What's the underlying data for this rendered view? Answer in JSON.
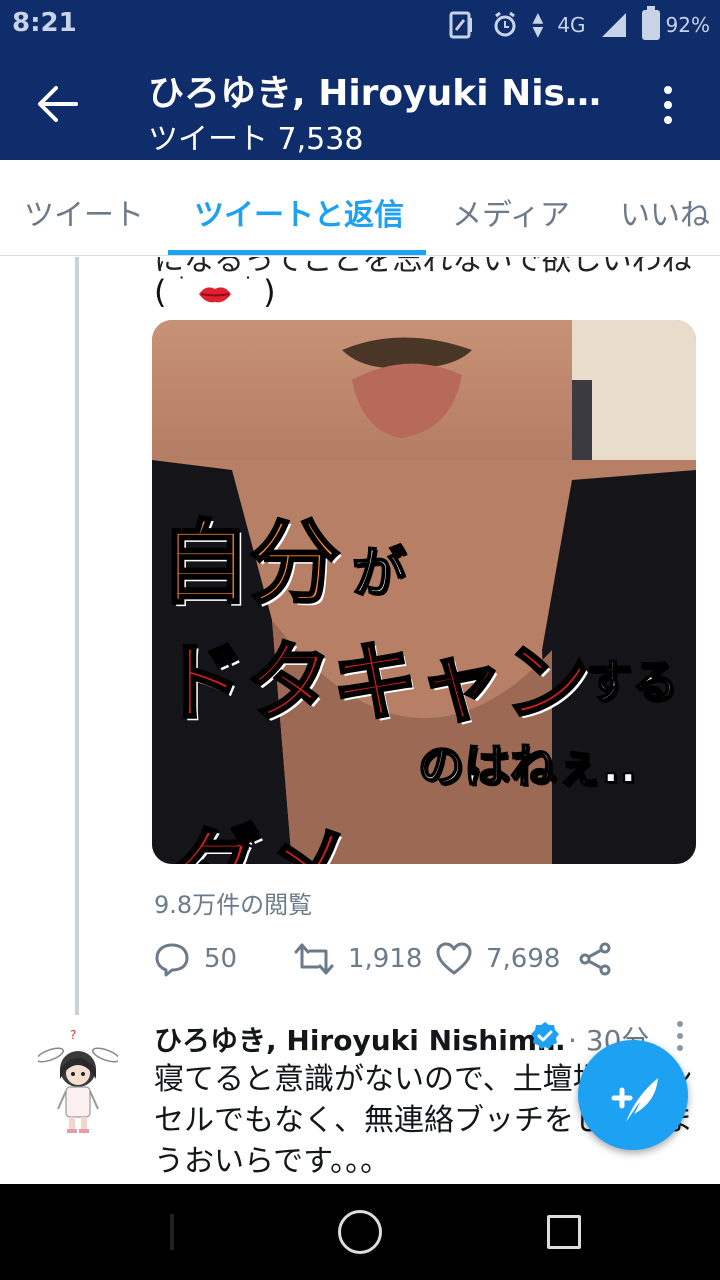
{
  "status_bar": {
    "time": "8:21",
    "network": "4G",
    "battery": "92%",
    "icons": [
      "nfc-icon",
      "alarm-icon",
      "data-arrows-icon",
      "signal-icon",
      "battery-icon"
    ]
  },
  "header": {
    "title": "ひろゆき, Hiroyuki Nis…",
    "subtitle": "ツイート 7,538",
    "back_icon": "arrow-left-icon",
    "menu_icon": "more-vertical-icon"
  },
  "tabs": [
    {
      "label": "ツイート",
      "active": false
    },
    {
      "label": "ツイートと返信",
      "active": true
    },
    {
      "label": "メディア",
      "active": false
    },
    {
      "label": "いいね",
      "active": false
    }
  ],
  "tweet1": {
    "cut_text": "になるってことを忘れないで欲しいわね",
    "emoji_line_open": "(",
    "emoji_line_close": ")",
    "media_captions": {
      "line1_big": "自分",
      "line1_small": "が",
      "line2_big": "ドタキャン",
      "line2_small": "する",
      "line3": "のはねぇ..",
      "line4": "ダメ"
    },
    "views": "9.8万件の閲覧",
    "replies": "50",
    "retweets": "1,918",
    "likes": "7,698"
  },
  "tweet2": {
    "name": "ひろゆき, Hiroyuki Nishim…",
    "time": "· 30分",
    "body": "寝てると意識がないので、土壇場キャンセルでもなく、無連絡ブッチをしてしまうおいらです。。。"
  },
  "colors": {
    "header_bg": "#0f2d6b",
    "accent": "#1da1f2",
    "muted_text": "#6b7b8a"
  }
}
